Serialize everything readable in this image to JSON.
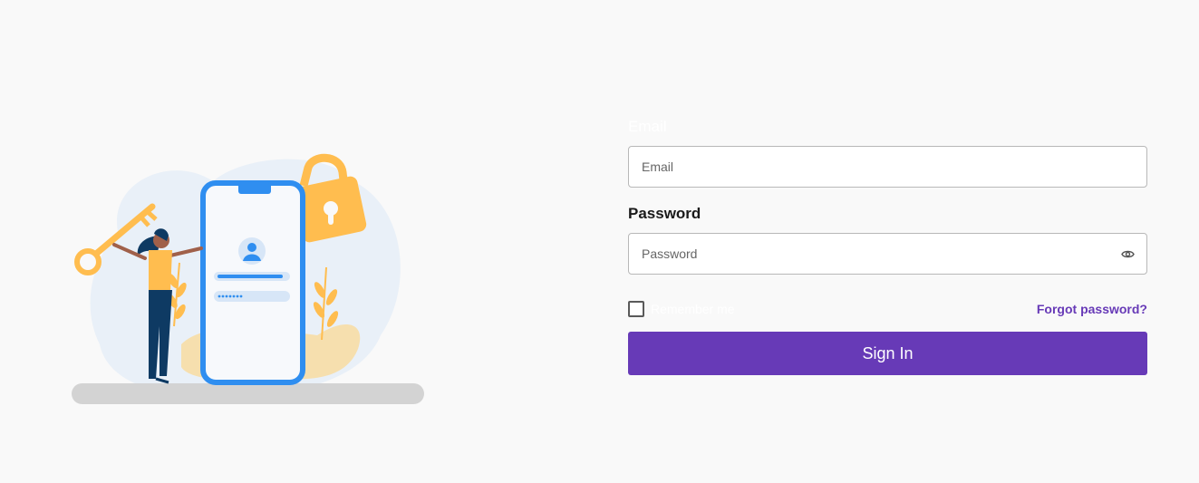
{
  "login": {
    "email_label": "Email",
    "email_placeholder": "Email",
    "password_label": "Password",
    "password_placeholder": "Password",
    "remember_label": "Remember me",
    "forgot_label": "Forgot password?",
    "signin_label": "Sign In"
  },
  "icons": {
    "password_toggle": "eye-icon",
    "illustration": "login-illustration"
  },
  "colors": {
    "accent": "#673ab7",
    "background": "#f9f9f9",
    "phone_blue": "#2f8ef0",
    "lock_yellow": "#ffbd4f"
  }
}
